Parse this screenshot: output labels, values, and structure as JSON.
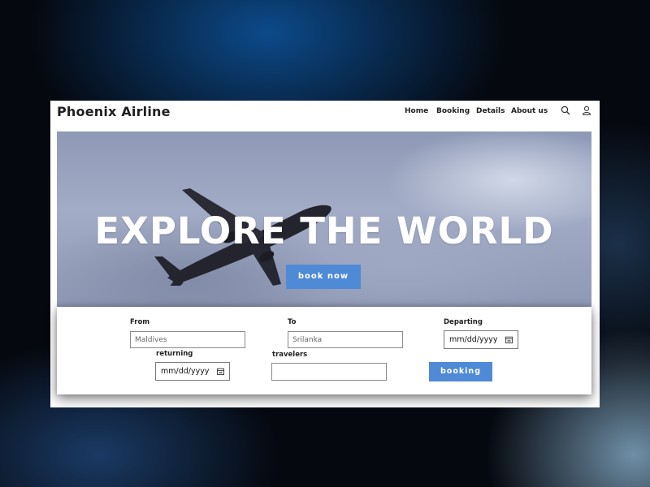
{
  "navbar": {
    "brand": "Phoenix Airline",
    "links": [
      "Home",
      "Booking",
      "Details",
      "About us"
    ],
    "icons": [
      "search-icon",
      "user-icon"
    ]
  },
  "hero": {
    "title": "EXPLORE THE WORLD",
    "button_label": "book now"
  },
  "booking_form": {
    "from_label": "From",
    "from_placeholder": "Maldives",
    "to_label": "To",
    "to_placeholder": "Srilanka",
    "departing_label": "Departing",
    "departing_value": "mm/dd/yyyy",
    "returning_label": "returning",
    "returning_value": "mm/dd/yyyy",
    "travelers_label": "travelers",
    "travelers_value": "",
    "submit_label": "booking"
  },
  "colors": {
    "accent": "#4f8ad6",
    "brand_text": "#1f1f1f",
    "hero_text": "#ffffff"
  }
}
